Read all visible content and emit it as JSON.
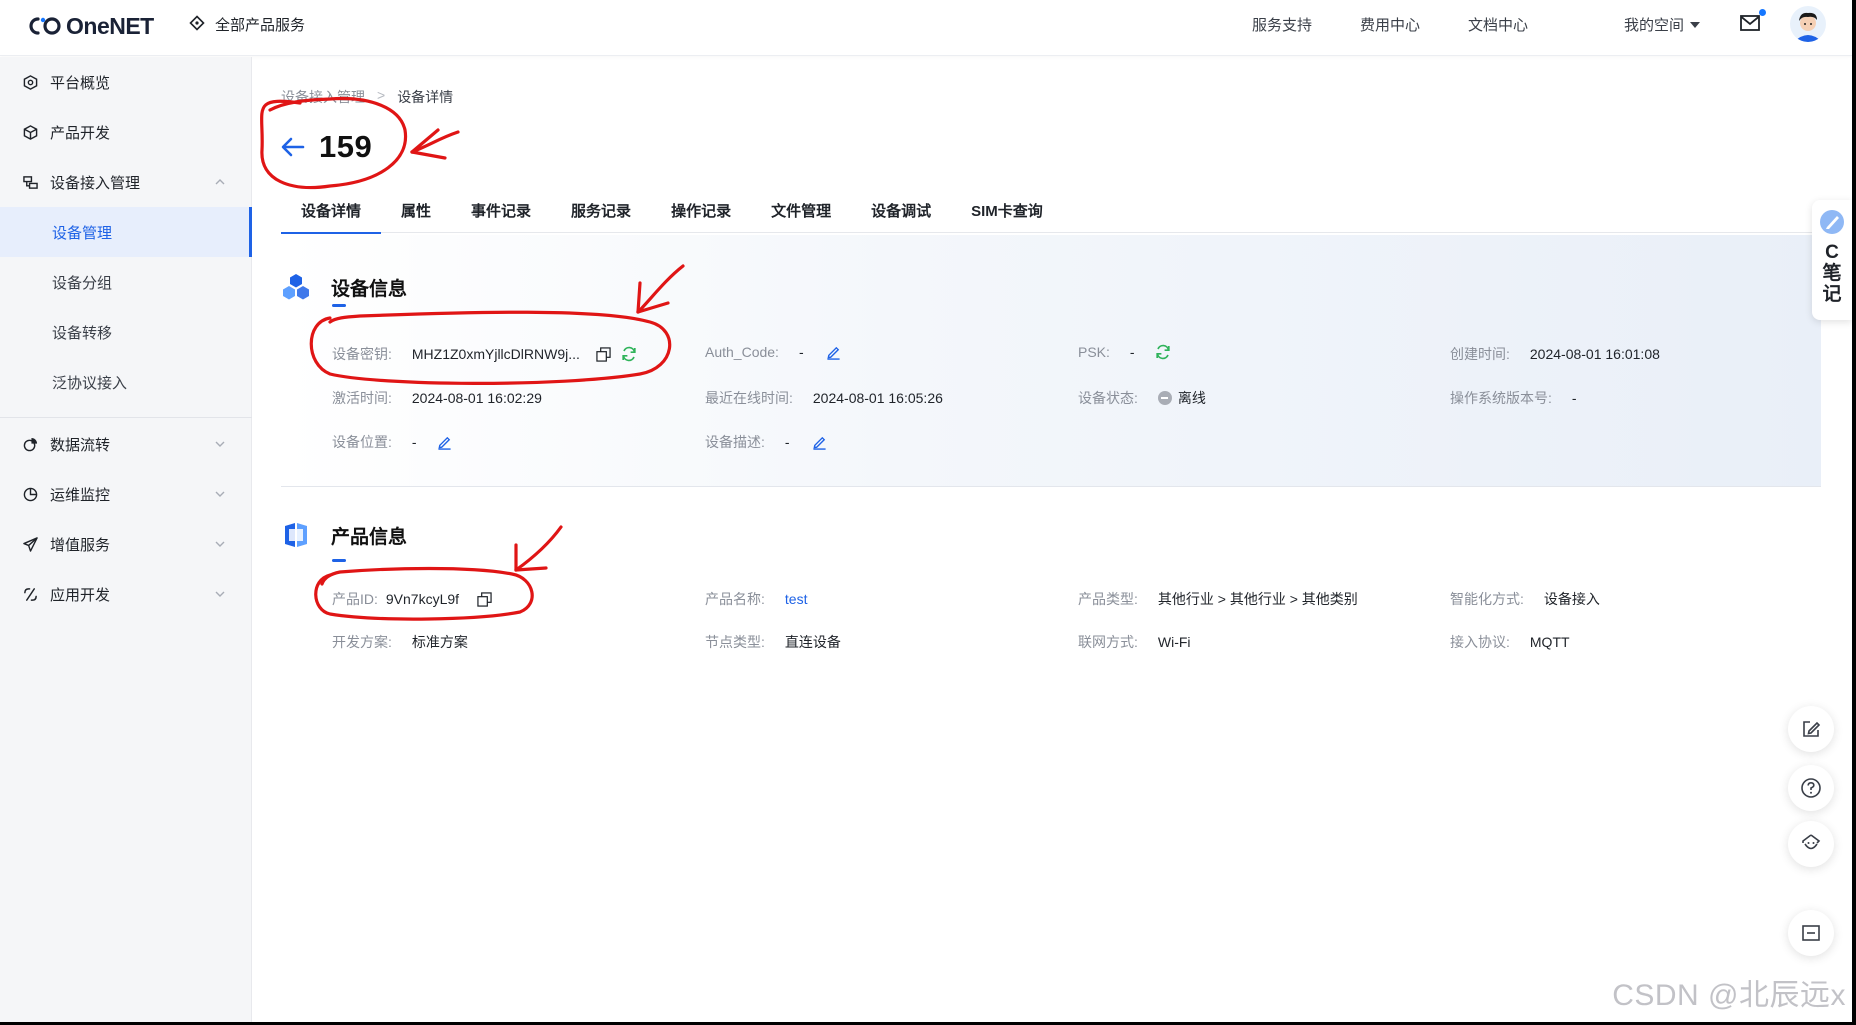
{
  "brand": {
    "logo_text": "OneNET"
  },
  "header": {
    "all_products": "全部产品服务",
    "links": [
      "服务支持",
      "费用中心",
      "文档中心"
    ],
    "my_space": "我的空间"
  },
  "sidebar": {
    "items": [
      {
        "label": "平台概览",
        "icon": "overview-icon"
      },
      {
        "label": "产品开发",
        "icon": "cube-icon"
      },
      {
        "label": "设备接入管理",
        "icon": "device-access-icon"
      },
      {
        "label": "数据流转",
        "icon": "data-flow-icon"
      },
      {
        "label": "运维监控",
        "icon": "monitor-icon"
      },
      {
        "label": "增值服务",
        "icon": "rocket-icon"
      },
      {
        "label": "应用开发",
        "icon": "app-dev-icon"
      }
    ],
    "subitems": [
      "设备管理",
      "设备分组",
      "设备转移",
      "泛协议接入"
    ],
    "active_subitem": "设备管理"
  },
  "breadcrumb": {
    "parent": "设备接入管理",
    "separator": ">",
    "current": "设备详情"
  },
  "page_title": "159",
  "tabs": [
    "设备详情",
    "属性",
    "事件记录",
    "服务记录",
    "操作记录",
    "文件管理",
    "设备调试",
    "SIM卡查询"
  ],
  "active_tab": "设备详情",
  "device_info": {
    "title": "设备信息",
    "device_key_label": "设备密钥:",
    "device_key_value": "MHZ1Z0xmYjllcDlRNW9j...",
    "auth_code_label": "Auth_Code:",
    "auth_code_value": "-",
    "psk_label": "PSK:",
    "psk_value": "-",
    "created_label": "创建时间:",
    "created_value": "2024-08-01 16:01:08",
    "activated_label": "激活时间:",
    "activated_value": "2024-08-01 16:02:29",
    "last_online_label": "最近在线时间:",
    "last_online_value": "2024-08-01 16:05:26",
    "status_label": "设备状态:",
    "status_value": "离线",
    "os_version_label": "操作系统版本号:",
    "os_version_value": "-",
    "location_label": "设备位置:",
    "location_value": "-",
    "description_label": "设备描述:",
    "description_value": "-"
  },
  "product_info": {
    "title": "产品信息",
    "product_id_label": "产品ID:",
    "product_id_value": "9Vn7kcyL9f",
    "product_name_label": "产品名称:",
    "product_name_value": "test",
    "product_type_label": "产品类型:",
    "product_type_value": "其他行业 > 其他行业 > 其他类别",
    "smart_mode_label": "智能化方式:",
    "smart_mode_value": "设备接入",
    "dev_plan_label": "开发方案:",
    "dev_plan_value": "标准方案",
    "node_type_label": "节点类型:",
    "node_type_value": "直连设备",
    "network_label": "联网方式:",
    "network_value": "Wi-Fi",
    "protocol_label": "接入协议:",
    "protocol_value": "MQTT"
  },
  "side_note": {
    "line1": "C",
    "line2": "笔",
    "line3": "记"
  },
  "watermark": "CSDN @北辰远x",
  "colors": {
    "primary": "#1e62e6",
    "annotation": "#e01515",
    "refresh": "#2fb35a"
  }
}
